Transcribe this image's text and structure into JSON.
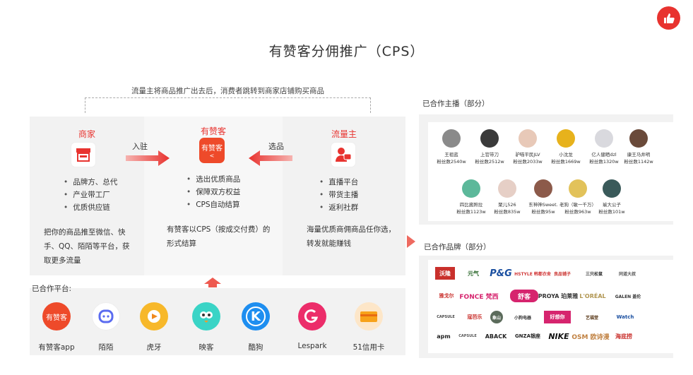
{
  "title": "有赞客分佣推广（CPS）",
  "flow_caption": "流量主将商品推广出去后，消费者跳转到商家店铺购买商品",
  "merchant": {
    "title": "商家",
    "bullets": [
      "品牌方、总代",
      "产业带工厂",
      "优质供应链"
    ],
    "desc_lines": [
      "把你的商品推至微信、快",
      "手、QQ、陌陌等平台，获",
      "取更多流量"
    ]
  },
  "youzanke": {
    "title": "有赞客",
    "icon_text": "有赞客",
    "bullets": [
      "选出优质商品",
      "保障双方权益",
      "CPS自动结算"
    ],
    "desc_lines": [
      "有赞客以CPS（按成交付费）的",
      "形式结算"
    ]
  },
  "traffic": {
    "title": "流量主",
    "bullets": [
      "直播平台",
      "带货主播",
      "返利社群"
    ],
    "desc_lines": [
      "海量优质商佣商品任你选，",
      "转发就能赚钱"
    ]
  },
  "arrow_left_label": "入驻",
  "arrow_right_label": "选品",
  "platforms_label": "已合作平台:",
  "platforms": [
    {
      "name": "有赞客app",
      "icon": "youzanke-app-icon",
      "text": "有赞客"
    },
    {
      "name": "陌陌",
      "icon": "momo-icon",
      "text": ""
    },
    {
      "name": "虎牙",
      "icon": "huya-icon",
      "text": ""
    },
    {
      "name": "映客",
      "icon": "yingke-icon",
      "text": ""
    },
    {
      "name": "酷狗",
      "icon": "kugou-icon",
      "text": "K"
    },
    {
      "name": "Lespark",
      "icon": "lespark-icon",
      "text": ""
    },
    {
      "name": "51信用卡",
      "icon": "51card-icon",
      "text": ""
    }
  ],
  "anchors_head": "已合作主播（部分）",
  "anchors_row1": [
    {
      "name": "王祖蓝",
      "fans": "粉丝数2540w"
    },
    {
      "name": "上官带刀",
      "fans": "粉丝数2512w"
    },
    {
      "name": "驴喵平民JLV",
      "fans": "粉丝数2033w"
    },
    {
      "name": "小沈龙",
      "fans": "粉丝数1669w"
    },
    {
      "name": "亿人健晒dzl",
      "fans": "粉丝数1320w"
    },
    {
      "name": "康王马井明",
      "fans": "粉丝数1142w"
    }
  ],
  "anchors_row2": [
    {
      "name": "四比酱照拉",
      "fans": "粉丝数1123w"
    },
    {
      "name": "聚儿526",
      "fans": "粉丝数835w"
    },
    {
      "name": "东神神Sweet.",
      "fans": "粉丝数95w"
    },
    {
      "name": "老狗（敏一千万）",
      "fans": "粉丝数963w"
    },
    {
      "name": "瑜大公子",
      "fans": "粉丝数101w"
    }
  ],
  "brands_head": "已合作品牌（部分）",
  "brands": [
    "沃隆",
    "元气",
    "P&G",
    "HSTYLE 韩都衣舍",
    "良品铺子",
    "三只松鼠",
    "同道大叔",
    "雅戈尔",
    "FONCE 梵西",
    "舒客",
    "PROYA 珀莱雅",
    "L'ORÉAL",
    "GALEN 盖伦",
    "CAPSULE",
    "寇芭乐",
    "象山",
    "小狗电器",
    "好想你",
    "艺福堂",
    "Watch",
    "apm",
    "CAPSULE",
    "ABACK",
    "GNZA银座",
    "NIKE",
    "OSM 欧诗漫",
    "海底捞"
  ]
}
